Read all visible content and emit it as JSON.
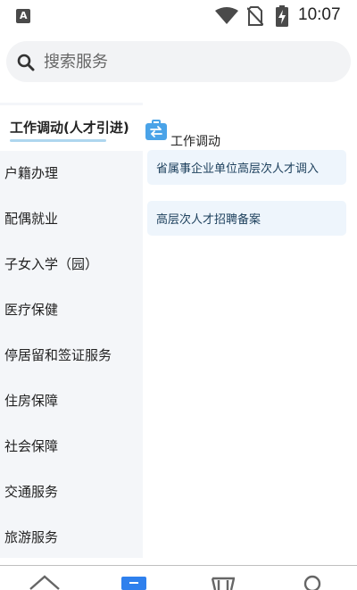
{
  "status_bar": {
    "app_icon_letter": "A",
    "time": "10:07"
  },
  "search": {
    "placeholder": "搜索服务"
  },
  "sidebar": {
    "items": [
      {
        "label": "工作调动(人才引进)",
        "active": true
      },
      {
        "label": "户籍办理"
      },
      {
        "label": "配偶就业"
      },
      {
        "label": "子女入学（园）"
      },
      {
        "label": "医疗保健"
      },
      {
        "label": "停居留和签证服务"
      },
      {
        "label": "住房保障"
      },
      {
        "label": "社会保障"
      },
      {
        "label": "交通服务"
      },
      {
        "label": "旅游服务"
      }
    ]
  },
  "content": {
    "section_title": "工作调动",
    "cards": [
      {
        "label": "省属事企业单位高层次人才调入"
      },
      {
        "label": "高层次人才招聘备案"
      }
    ]
  },
  "bottom_nav": {
    "items": [
      {
        "icon": "home-icon"
      },
      {
        "icon": "services-icon",
        "active": true
      },
      {
        "icon": "shop-icon"
      },
      {
        "icon": "profile-icon"
      }
    ]
  },
  "colors": {
    "active_accent": "#2f80ed",
    "card_bg": "#eef5fc",
    "sidebar_bg": "#f4f6f9"
  }
}
